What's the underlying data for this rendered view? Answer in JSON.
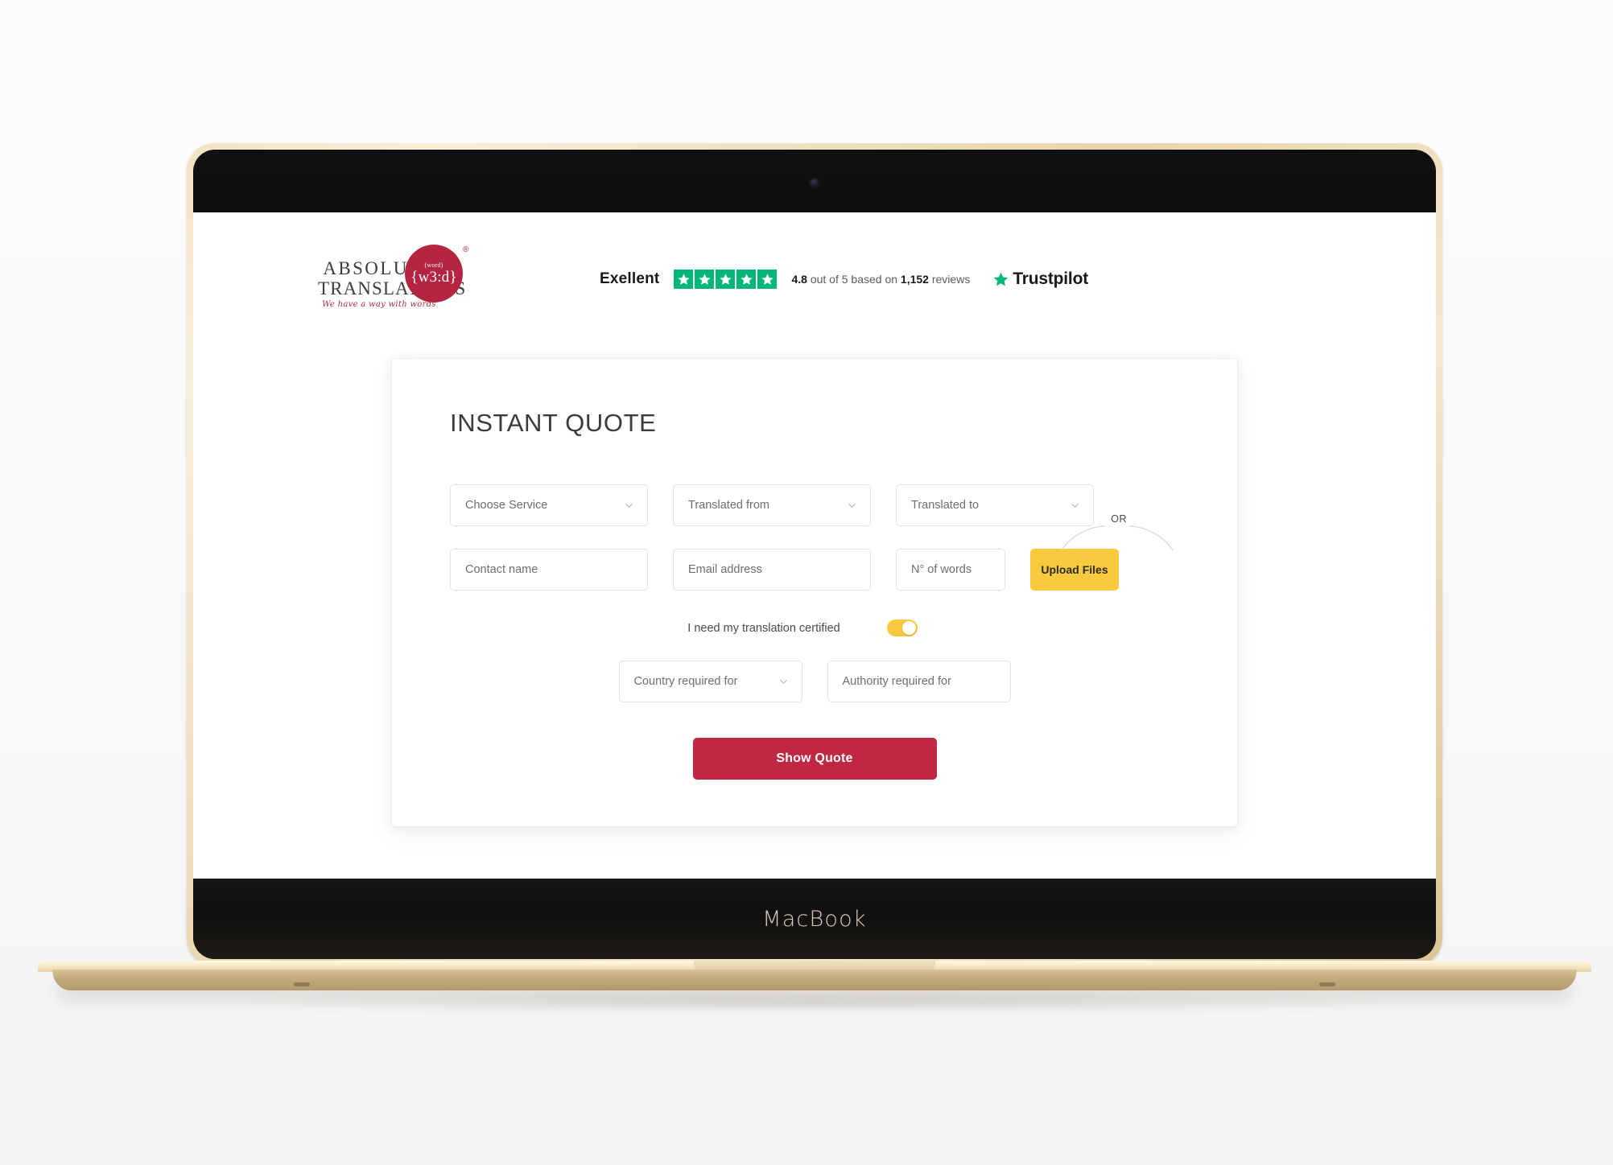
{
  "device": {
    "label": "MacBook"
  },
  "header": {
    "logo": {
      "line1": "ABSOLUTE",
      "line2": "TRANSLATIONS",
      "tagline": "We have a way with words",
      "bubble_small": "(word)",
      "bubble_main": "{w3:d}",
      "registered_mark": "®"
    },
    "trustpilot": {
      "verdict": "Exellent",
      "stars": 5,
      "rating_value": "4.8",
      "rating_rest": " out of 5 based on ",
      "review_count": "1,152",
      "review_suffix": " reviews",
      "brand_name": "Trustpilot",
      "star_color": "#00b67a"
    }
  },
  "quote_form": {
    "title": "INSTANT QUOTE",
    "row1": [
      {
        "name": "service",
        "label": "Choose Service",
        "type": "select"
      },
      {
        "name": "source-language",
        "label": "Translated from",
        "type": "select"
      },
      {
        "name": "target-language",
        "label": "Translated to",
        "type": "select"
      }
    ],
    "row2": {
      "contact_name": "Contact name",
      "email_address": "Email address",
      "word_count": "N° of words",
      "or_label": "OR",
      "upload_label": "Upload Files"
    },
    "certified": {
      "label": "I need my translation certified",
      "enabled": true
    },
    "row3": {
      "country": "Country required for",
      "authority": "Authority required for"
    },
    "submit_label": "Show Quote",
    "colors": {
      "accent_red": "#c02742",
      "accent_yellow": "#fbc93d"
    }
  }
}
